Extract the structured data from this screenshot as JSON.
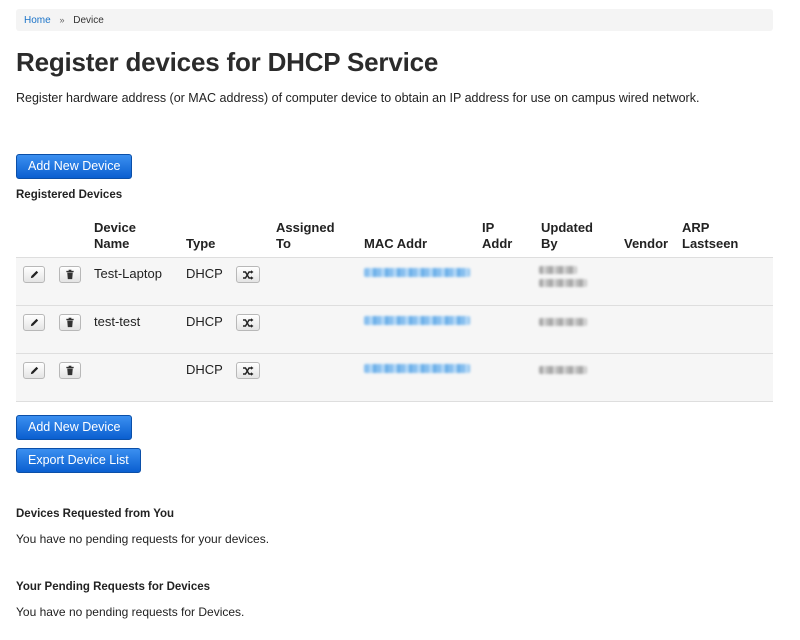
{
  "breadcrumb": {
    "home": "Home",
    "separator": "»",
    "current": "Device"
  },
  "header": {
    "title": "Register devices for DHCP Service",
    "subtitle": "Register hardware address (or MAC address) of computer device to obtain an IP address for use on campus wired network."
  },
  "buttons": {
    "add_new_device": "Add New Device",
    "export_device_list": "Export Device List"
  },
  "registered": {
    "heading": "Registered Devices",
    "columns": {
      "device_name_1": "Device",
      "device_name_2": "Name",
      "type": "Type",
      "assigned_1": "Assigned",
      "assigned_2": "To",
      "mac": "MAC Addr",
      "ip_1": "IP",
      "ip_2": "Addr",
      "updated_1": "Updated",
      "updated_2": "By",
      "vendor": "Vendor",
      "arp_1": "ARP",
      "arp_2": "Lastseen"
    },
    "rows": [
      {
        "name": "Test-Laptop",
        "type": "DHCP"
      },
      {
        "name": "test-test",
        "type": "DHCP"
      },
      {
        "name": "",
        "type": "DHCP"
      }
    ]
  },
  "requested_from_you": {
    "heading": "Devices Requested from You",
    "message": "You have no pending requests for your devices."
  },
  "your_pending": {
    "heading": "Your Pending Requests for Devices",
    "message": "You have no pending requests for Devices."
  },
  "icons": {
    "edit": "pencil-icon",
    "delete": "trash-icon",
    "assign": "shuffle-icon"
  },
  "colors": {
    "primary": "#0a5fd0",
    "link": "#1a73c8",
    "row_bg": "#f6f6f6"
  }
}
